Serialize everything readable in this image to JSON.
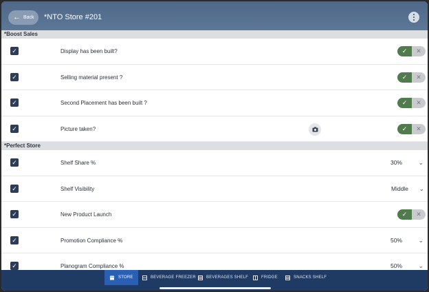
{
  "header": {
    "back_label": "Back",
    "title": "*NTO Store #201"
  },
  "sections": [
    {
      "title": "*Boost Sales",
      "rows": [
        {
          "label": "Display has been built?",
          "control": "toggle",
          "value": "yes"
        },
        {
          "label": "Selling material present ?",
          "control": "toggle",
          "value": "yes"
        },
        {
          "label": "Second Placement has been built ?",
          "control": "toggle",
          "value": "yes"
        },
        {
          "label": "Picture taken?",
          "control": "toggle",
          "value": "yes",
          "camera": true
        }
      ]
    },
    {
      "title": "*Perfect Store",
      "rows": [
        {
          "label": "Shelf Share %",
          "control": "select",
          "value": "30%"
        },
        {
          "label": "Shelf Visibility",
          "control": "select",
          "value": "Middle"
        },
        {
          "label": "New Product Launch",
          "control": "toggle",
          "value": "yes"
        },
        {
          "label": "Promotion Compliance %",
          "control": "select",
          "value": "50%"
        },
        {
          "label": "Planogram Compliance %",
          "control": "select",
          "value": "50%"
        }
      ]
    }
  ],
  "tabs": [
    {
      "label": "STORE",
      "icon": "store-icon",
      "active": true
    },
    {
      "label": "BEVERAGE FREEZER",
      "icon": "freezer-icon",
      "active": false
    },
    {
      "label": "BEVERAGES SHELF",
      "icon": "shelf-icon",
      "active": false
    },
    {
      "label": "FRIDGE",
      "icon": "fridge-icon",
      "active": false
    },
    {
      "label": "SNACKS SHELF",
      "icon": "shelf-icon",
      "active": false
    }
  ],
  "colors": {
    "header": "#5d7797",
    "toggle_on": "#4f7b4d",
    "checkbox": "#2f3c55",
    "footer": "#1f3a63",
    "active_tab": "#2a5fb4"
  }
}
